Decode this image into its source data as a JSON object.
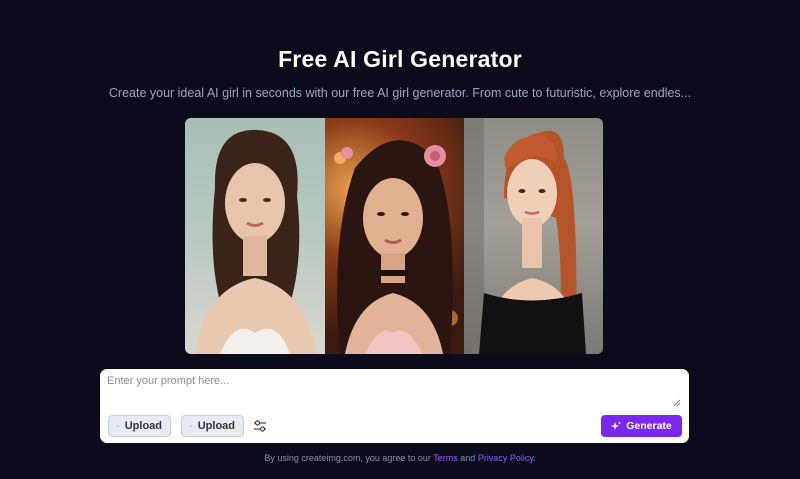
{
  "header": {
    "title": "Free AI Girl Generator",
    "subtitle": "Create your ideal AI girl in seconds with our free AI girl generator. From cute to futuristic, explore endles..."
  },
  "gallery": {
    "images": [
      {
        "name": "portrait-1"
      },
      {
        "name": "portrait-2"
      },
      {
        "name": "portrait-3"
      }
    ]
  },
  "prompt": {
    "placeholder": "Enter your prompt here...",
    "value": ""
  },
  "toolbar": {
    "upload_label_1": "Upload",
    "upload_label_2": "Upload",
    "generate_label": "Generate",
    "icons": [
      "paperclip-icon",
      "paperclip-icon",
      "sliders-icon",
      "sparkle-icon"
    ]
  },
  "footer": {
    "prefix": "By using createimg.com, you agree to our",
    "terms": "Terms",
    "and": "and",
    "privacy": "Privacy Policy",
    "suffix": "."
  },
  "colors": {
    "background": "#0b0b1c",
    "accent": "#7c27f0",
    "link": "#9b55ff"
  }
}
